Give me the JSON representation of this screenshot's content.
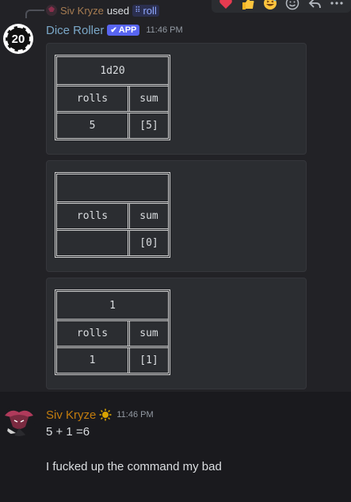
{
  "reply": {
    "user": "Siv Kryze",
    "used_text": "used",
    "command_icon": "slash-command-icon",
    "command": "roll"
  },
  "reactions": [
    "heart-icon",
    "thumbs-up-icon",
    "grin-sweat-icon",
    "add-reaction-icon",
    "reply-icon",
    "more-icon"
  ],
  "bot_message": {
    "username": "Dice Roller",
    "badge": "APP",
    "timestamp": "11:46 PM",
    "avatar_text": "20",
    "embeds": [
      {
        "title": "1d20",
        "col1": "rolls",
        "col2": "sum",
        "val1": "5",
        "val2": "[5]"
      },
      {
        "title": "",
        "col1": "rolls",
        "col2": "sum",
        "val1": "",
        "val2": "[0]"
      },
      {
        "title": "1",
        "col1": "rolls",
        "col2": "sum",
        "val1": "1",
        "val2": "[1]"
      }
    ]
  },
  "user_message": {
    "username": "Siv Kryze",
    "timestamp": "11:46 PM",
    "lines": [
      "5 + 1 =6",
      "I fucked up the command my bad"
    ]
  },
  "colors": {
    "bot_name": "#7aa7c7",
    "user_name": "#c27c0e",
    "app_badge": "#5865f2",
    "embed_bg": "#2b2d31"
  }
}
